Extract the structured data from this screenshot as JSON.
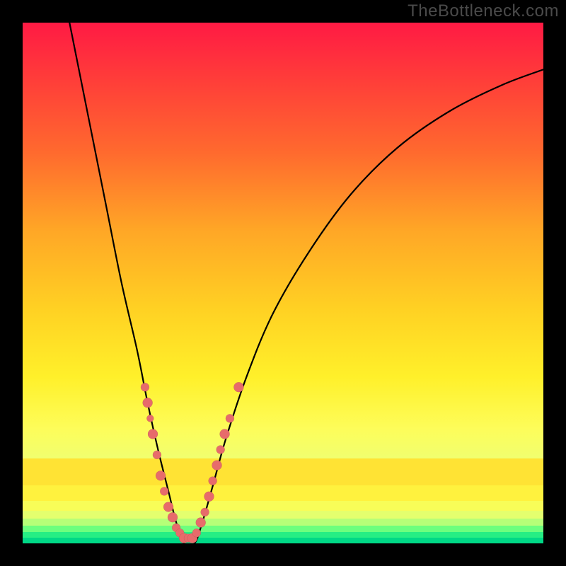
{
  "watermark": "TheBottleneck.com",
  "chart_data": {
    "type": "line",
    "title": "",
    "xlabel": "",
    "ylabel": "",
    "xlim": [
      0,
      100
    ],
    "ylim": [
      0,
      100
    ],
    "curve": {
      "name": "bottleneck-curve",
      "points": [
        {
          "x": 9,
          "y": 100
        },
        {
          "x": 12,
          "y": 85
        },
        {
          "x": 16,
          "y": 65
        },
        {
          "x": 19,
          "y": 50
        },
        {
          "x": 22,
          "y": 37
        },
        {
          "x": 24,
          "y": 27
        },
        {
          "x": 26,
          "y": 18
        },
        {
          "x": 28,
          "y": 10
        },
        {
          "x": 29.5,
          "y": 4
        },
        {
          "x": 31,
          "y": 0
        },
        {
          "x": 33,
          "y": 0
        },
        {
          "x": 34.5,
          "y": 4
        },
        {
          "x": 36.5,
          "y": 11
        },
        {
          "x": 39,
          "y": 20
        },
        {
          "x": 43,
          "y": 32
        },
        {
          "x": 48,
          "y": 44
        },
        {
          "x": 55,
          "y": 56
        },
        {
          "x": 63,
          "y": 67
        },
        {
          "x": 72,
          "y": 76
        },
        {
          "x": 82,
          "y": 83
        },
        {
          "x": 92,
          "y": 88
        },
        {
          "x": 100,
          "y": 91
        }
      ]
    },
    "scatter": {
      "name": "sample-points",
      "points": [
        {
          "x": 23.5,
          "y": 30,
          "r": 6
        },
        {
          "x": 24,
          "y": 27,
          "r": 7
        },
        {
          "x": 24.5,
          "y": 24,
          "r": 5
        },
        {
          "x": 25,
          "y": 21,
          "r": 7
        },
        {
          "x": 25.8,
          "y": 17,
          "r": 6
        },
        {
          "x": 26.5,
          "y": 13,
          "r": 7
        },
        {
          "x": 27.2,
          "y": 10,
          "r": 6
        },
        {
          "x": 28,
          "y": 7,
          "r": 7
        },
        {
          "x": 28.8,
          "y": 5,
          "r": 7
        },
        {
          "x": 29.5,
          "y": 3,
          "r": 6
        },
        {
          "x": 30.2,
          "y": 2,
          "r": 6
        },
        {
          "x": 31,
          "y": 1,
          "r": 7
        },
        {
          "x": 31.8,
          "y": 1,
          "r": 6
        },
        {
          "x": 32.6,
          "y": 1,
          "r": 7
        },
        {
          "x": 33.4,
          "y": 2,
          "r": 6
        },
        {
          "x": 34.2,
          "y": 4,
          "r": 7
        },
        {
          "x": 35,
          "y": 6,
          "r": 6
        },
        {
          "x": 35.8,
          "y": 9,
          "r": 7
        },
        {
          "x": 36.5,
          "y": 12,
          "r": 6
        },
        {
          "x": 37.3,
          "y": 15,
          "r": 7
        },
        {
          "x": 38,
          "y": 18,
          "r": 6
        },
        {
          "x": 38.8,
          "y": 21,
          "r": 7
        },
        {
          "x": 39.8,
          "y": 24,
          "r": 6
        },
        {
          "x": 41.5,
          "y": 30,
          "r": 7
        }
      ]
    },
    "gradient_bands": [
      {
        "bottom": 0,
        "height": 8,
        "color": "#00d886"
      },
      {
        "bottom": 8,
        "height": 8,
        "color": "#26ee84"
      },
      {
        "bottom": 16,
        "height": 9,
        "color": "#6cff7e"
      },
      {
        "bottom": 25,
        "height": 10,
        "color": "#b6ff78"
      },
      {
        "bottom": 35,
        "height": 11,
        "color": "#e4ff6e"
      },
      {
        "bottom": 46,
        "height": 14,
        "color": "#f8fd58"
      },
      {
        "bottom": 60,
        "height": 22,
        "color": "#fff23e"
      },
      {
        "bottom": 82,
        "height": 38,
        "color": "#ffe334"
      }
    ]
  }
}
